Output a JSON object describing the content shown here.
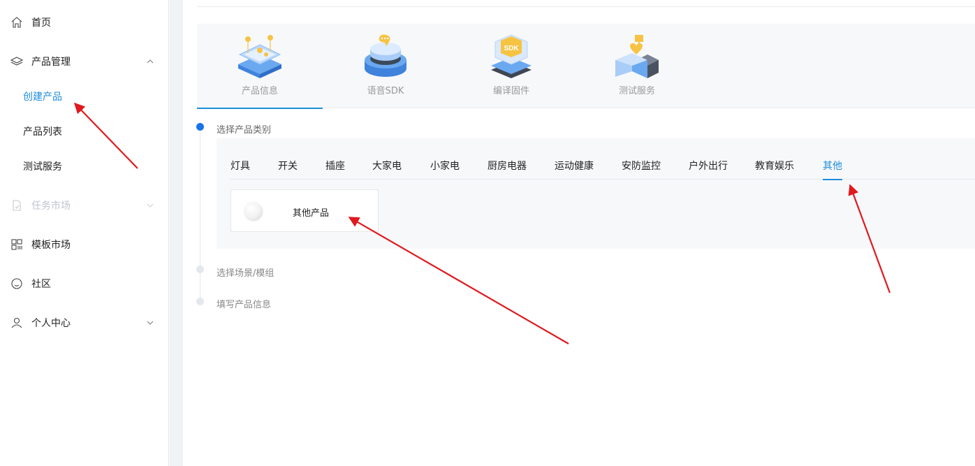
{
  "sidebar": {
    "items": [
      {
        "label": "首页",
        "icon": "home-icon"
      },
      {
        "label": "产品管理",
        "icon": "layers-icon",
        "expanded": true,
        "children": [
          {
            "label": "创建产品",
            "active": true
          },
          {
            "label": "产品列表"
          },
          {
            "label": "测试服务"
          }
        ]
      },
      {
        "label": "任务市场",
        "icon": "document-icon",
        "disabled": true
      },
      {
        "label": "模板市场",
        "icon": "grid-icon"
      },
      {
        "label": "社区",
        "icon": "smile-icon"
      },
      {
        "label": "个人中心",
        "icon": "user-icon"
      }
    ]
  },
  "steps": {
    "tabs": [
      {
        "label": "产品信息",
        "active": true
      },
      {
        "label": "语音SDK"
      },
      {
        "label": "编译固件"
      },
      {
        "label": "测试服务"
      }
    ],
    "sdk_badge": "SDK"
  },
  "wizard": {
    "step1": "选择产品类别",
    "step2": "选择场景/模组",
    "step3": "填写产品信息"
  },
  "categories": {
    "tabs": [
      "灯具",
      "开关",
      "插座",
      "大家电",
      "小家电",
      "厨房电器",
      "运动健康",
      "安防监控",
      "户外出行",
      "教育娱乐",
      "其他"
    ],
    "active": "其他"
  },
  "products": [
    {
      "label": "其他产品"
    }
  ],
  "colors": {
    "accent": "#1c8ddb",
    "step_dot": "#1a73e8",
    "annotation": "#e0191e"
  }
}
